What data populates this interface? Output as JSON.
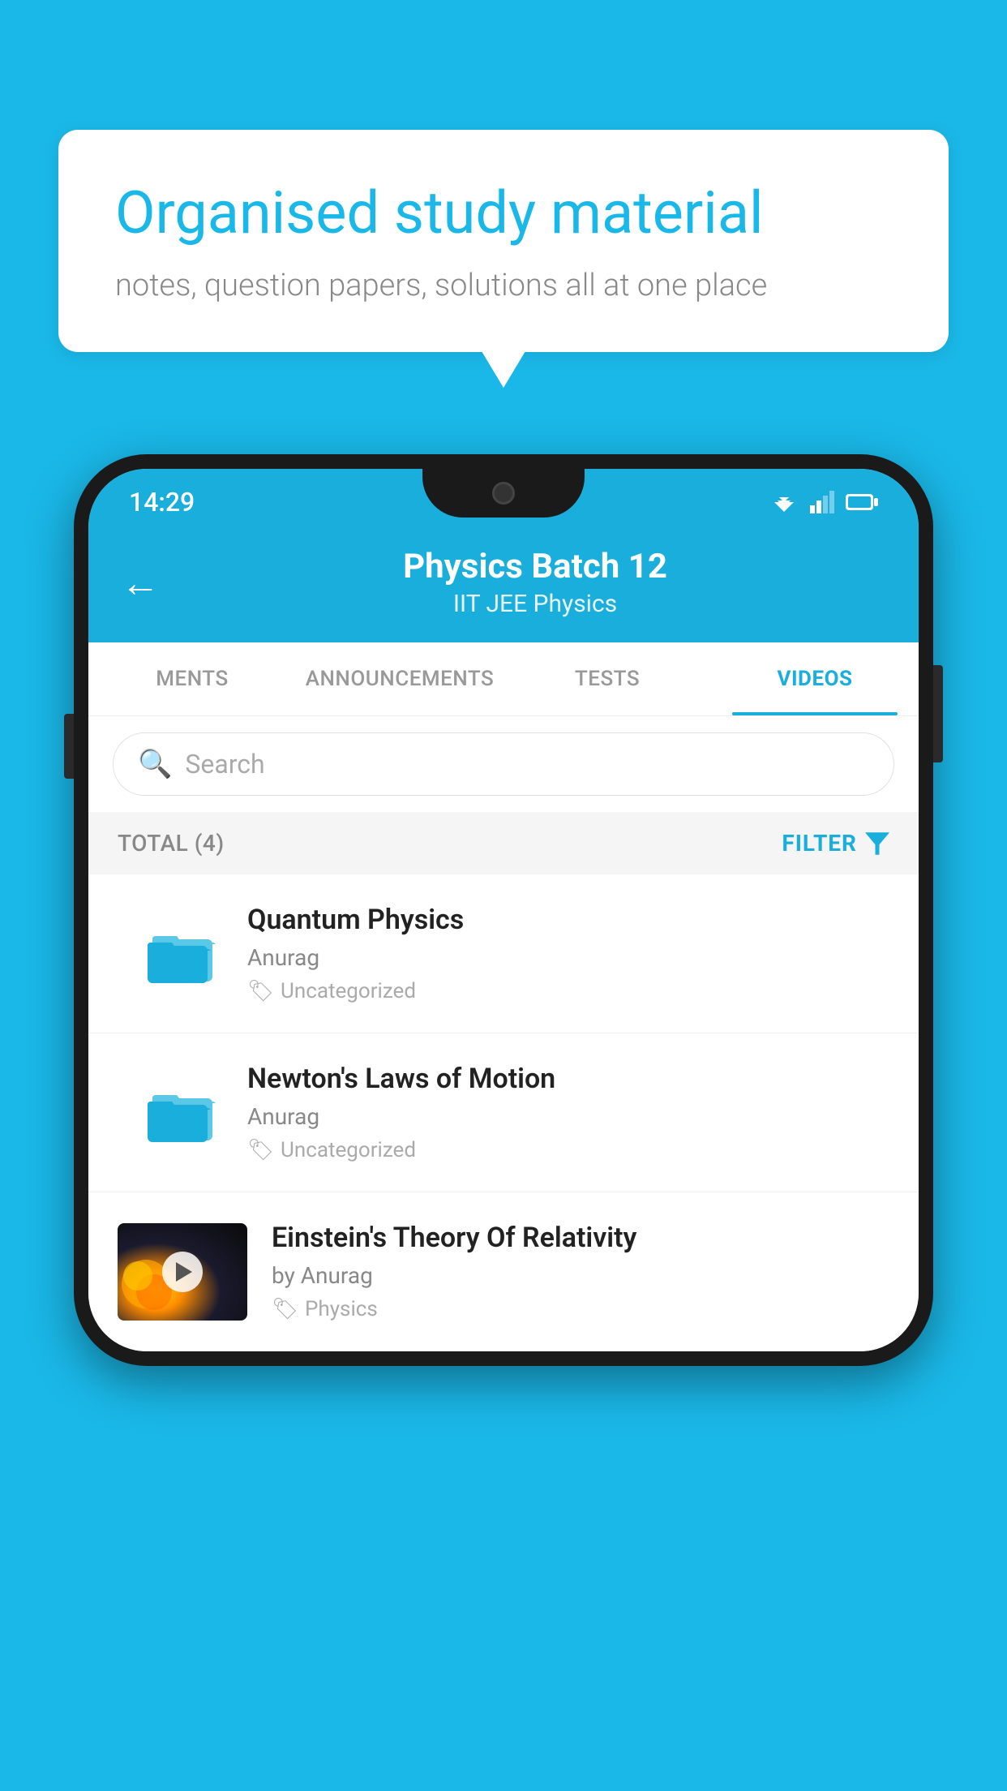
{
  "background_color": "#1ab8e8",
  "speech_bubble": {
    "title": "Organised study material",
    "subtitle": "notes, question papers, solutions all at one place"
  },
  "phone": {
    "status_bar": {
      "time": "14:29",
      "wifi": "▼▲",
      "battery": "▮"
    },
    "header": {
      "back_label": "←",
      "title": "Physics Batch 12",
      "subtitle": "IIT JEE   Physics"
    },
    "tabs": [
      {
        "label": "MENTS",
        "active": false
      },
      {
        "label": "ANNOUNCEMENTS",
        "active": false
      },
      {
        "label": "TESTS",
        "active": false
      },
      {
        "label": "VIDEOS",
        "active": true
      }
    ],
    "search": {
      "placeholder": "Search"
    },
    "filter": {
      "total_label": "TOTAL (4)",
      "filter_label": "FILTER"
    },
    "videos": [
      {
        "id": 1,
        "title": "Quantum Physics",
        "author": "Anurag",
        "tag": "Uncategorized",
        "type": "folder"
      },
      {
        "id": 2,
        "title": "Newton's Laws of Motion",
        "author": "Anurag",
        "tag": "Uncategorized",
        "type": "folder"
      },
      {
        "id": 3,
        "title": "Einstein's Theory Of Relativity",
        "author": "by Anurag",
        "tag": "Physics",
        "type": "video"
      }
    ]
  }
}
